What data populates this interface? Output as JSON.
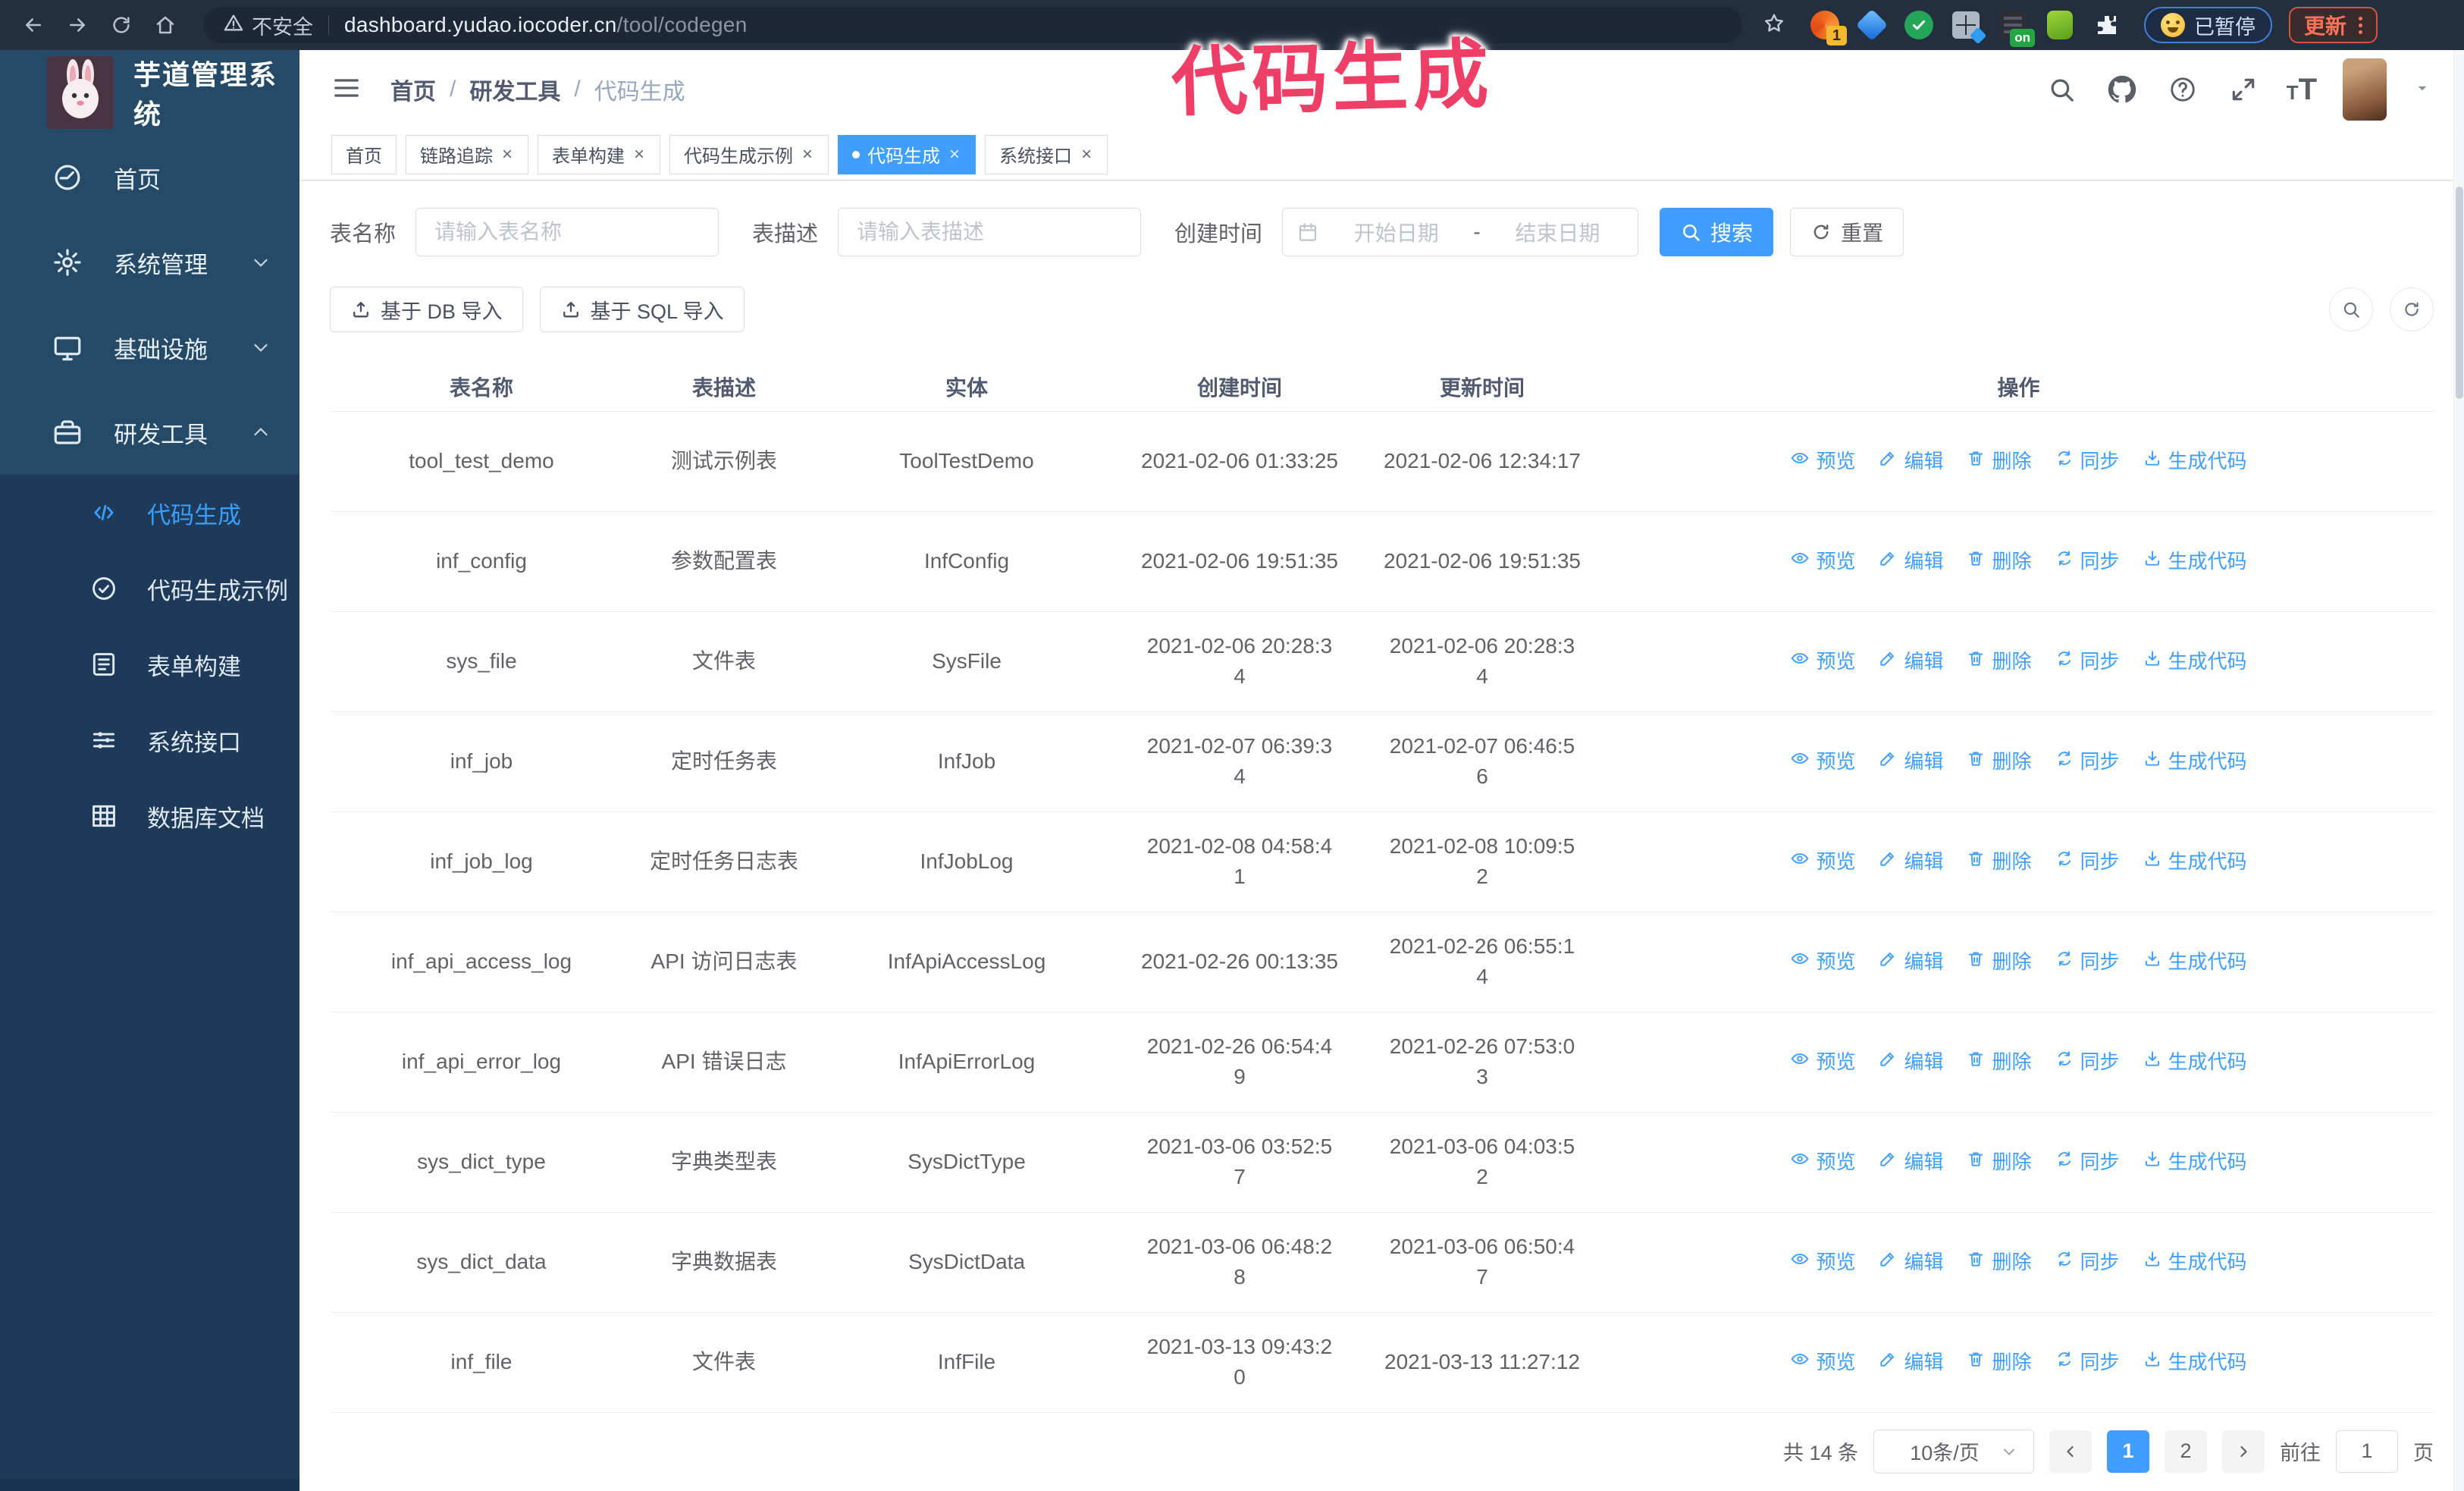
{
  "colors": {
    "primary": "#409eff",
    "sidebar_bg": "#254a68",
    "sidebar_submenu_bg": "#1e3a58",
    "chrome_bg": "#232e3e",
    "annotation_pink": "#ef3f66",
    "update_orange": "#ff7258",
    "paused_border": "#3f7fd8",
    "active_tab_bg": "#409eff"
  },
  "annotation": {
    "text": "代码生成"
  },
  "browser": {
    "insecure_label": "不安全",
    "url_host": "dashboard.yudao.iocoder.cn",
    "url_path": "/tool/codegen",
    "extension_badge": "1",
    "extension_on_badge": "on",
    "paused_badge": "已暂停",
    "update_button": "更新"
  },
  "sidebar": {
    "logo_title": "芋道管理系统",
    "items": [
      {
        "label": "首页",
        "icon": "home-icon",
        "arrow": ""
      },
      {
        "label": "系统管理",
        "icon": "gear-icon",
        "arrow": "down"
      },
      {
        "label": "基础设施",
        "icon": "monitor-icon",
        "arrow": "down"
      },
      {
        "label": "研发工具",
        "icon": "toolbox-icon",
        "arrow": "up"
      }
    ],
    "submenu": [
      {
        "label": "代码生成",
        "icon": "code-icon",
        "active": true
      },
      {
        "label": "代码生成示例",
        "icon": "example-icon",
        "active": false
      },
      {
        "label": "表单构建",
        "icon": "form-icon",
        "active": false
      },
      {
        "label": "系统接口",
        "icon": "api-icon",
        "active": false
      },
      {
        "label": "数据库文档",
        "icon": "database-icon",
        "active": false
      }
    ]
  },
  "navbar": {
    "breadcrumb": [
      "首页",
      "研发工具",
      "代码生成"
    ]
  },
  "tabs": [
    {
      "label": "首页",
      "closable": false,
      "active": false
    },
    {
      "label": "链路追踪",
      "closable": true,
      "active": false
    },
    {
      "label": "表单构建",
      "closable": true,
      "active": false
    },
    {
      "label": "代码生成示例",
      "closable": true,
      "active": false
    },
    {
      "label": "代码生成",
      "closable": true,
      "active": true
    },
    {
      "label": "系统接口",
      "closable": true,
      "active": false
    }
  ],
  "filters": {
    "name_label": "表名称",
    "name_placeholder": "请输入表名称",
    "desc_label": "表描述",
    "desc_placeholder": "请输入表描述",
    "time_label": "创建时间",
    "start_placeholder": "开始日期",
    "range_separator": "-",
    "end_placeholder": "结束日期",
    "search_label": "搜索",
    "search_icon": "search-icon",
    "reset_label": "重置",
    "reset_icon": "refresh-icon"
  },
  "toolbar": {
    "db_import": "基于 DB 导入",
    "sql_import": "基于 SQL 导入",
    "import_icon": "upload-icon",
    "mini_buttons": [
      "search-icon",
      "refresh-icon"
    ]
  },
  "table": {
    "headers": [
      "表名称",
      "表描述",
      "实体",
      "创建时间",
      "更新时间",
      "操作"
    ],
    "actions": [
      {
        "label": "预览",
        "icon": "eye-icon"
      },
      {
        "label": "编辑",
        "icon": "edit-icon"
      },
      {
        "label": "删除",
        "icon": "delete-icon"
      },
      {
        "label": "同步",
        "icon": "sync-icon"
      },
      {
        "label": "生成代码",
        "icon": "download-icon"
      }
    ],
    "rows": [
      {
        "name": "tool_test_demo",
        "desc": "测试示例表",
        "entity": "ToolTestDemo",
        "created": "2021-02-06 01:33:25",
        "updated": "2021-02-06 12:34:17"
      },
      {
        "name": "inf_config",
        "desc": "参数配置表",
        "entity": "InfConfig",
        "created": "2021-02-06 19:51:35",
        "updated": "2021-02-06 19:51:35"
      },
      {
        "name": "sys_file",
        "desc": "文件表",
        "entity": "SysFile",
        "created": "2021-02-06 20:28:3\n4",
        "updated": "2021-02-06 20:28:3\n4"
      },
      {
        "name": "inf_job",
        "desc": "定时任务表",
        "entity": "InfJob",
        "created": "2021-02-07 06:39:3\n4",
        "updated": "2021-02-07 06:46:5\n6"
      },
      {
        "name": "inf_job_log",
        "desc": "定时任务日志表",
        "entity": "InfJobLog",
        "created": "2021-02-08 04:58:4\n1",
        "updated": "2021-02-08 10:09:5\n2"
      },
      {
        "name": "inf_api_access_log",
        "desc": "API 访问日志表",
        "entity": "InfApiAccessLog",
        "created": "2021-02-26 00:13:35",
        "updated": "2021-02-26 06:55:1\n4"
      },
      {
        "name": "inf_api_error_log",
        "desc": "API 错误日志",
        "entity": "InfApiErrorLog",
        "created": "2021-02-26 06:54:4\n9",
        "updated": "2021-02-26 07:53:0\n3"
      },
      {
        "name": "sys_dict_type",
        "desc": "字典类型表",
        "entity": "SysDictType",
        "created": "2021-03-06 03:52:5\n7",
        "updated": "2021-03-06 04:03:5\n2"
      },
      {
        "name": "sys_dict_data",
        "desc": "字典数据表",
        "entity": "SysDictData",
        "created": "2021-03-06 06:48:2\n8",
        "updated": "2021-03-06 06:50:4\n7"
      },
      {
        "name": "inf_file",
        "desc": "文件表",
        "entity": "InfFile",
        "created": "2021-03-13 09:43:2\n0",
        "updated": "2021-03-13 11:27:12"
      }
    ]
  },
  "pagination": {
    "total": "共 14 条",
    "page_size": "10条/页",
    "pages": [
      "1",
      "2"
    ],
    "active_page": "1",
    "goto_label": "前往",
    "goto_value": "1",
    "page_suffix": "页"
  }
}
